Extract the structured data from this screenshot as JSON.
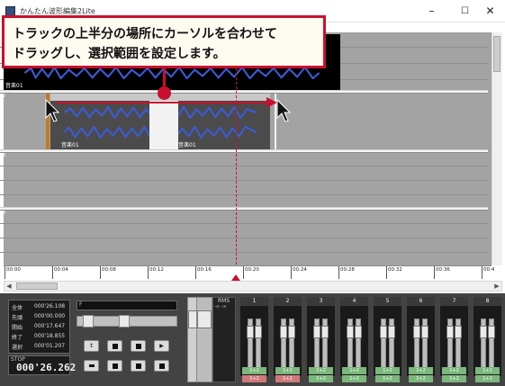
{
  "window": {
    "title": "かんたん波形編集2Lite",
    "controls": {
      "minimize": "–",
      "maximize": "☐",
      "close": "✕"
    }
  },
  "callout": {
    "line1": "トラックの上半分の場所にカーソルを合わせて",
    "line2": "ドラッグし、選択範囲を設定します。"
  },
  "tracks": [
    {
      "number": "1",
      "clips": [
        {
          "label": "音楽01"
        }
      ]
    },
    {
      "number": "2",
      "clips": [
        {
          "label": "音楽01"
        },
        {
          "label": "音楽01"
        }
      ]
    },
    {
      "number": "3",
      "clips": []
    },
    {
      "number": "4",
      "clips": []
    }
  ],
  "timeline": {
    "ticks": [
      "00:00",
      "00:04",
      "00:08",
      "00:12",
      "00:16",
      "00:20",
      "00:24",
      "00:28",
      "00:32",
      "00:36",
      "00:4"
    ]
  },
  "info": {
    "rows": [
      {
        "key": "全体",
        "value": "000'26.108"
      },
      {
        "key": "先頭",
        "value": "000'00.000"
      },
      {
        "key": "開始",
        "value": "000'17.647"
      },
      {
        "key": "終了",
        "value": "000'18.855"
      },
      {
        "key": "選択",
        "value": "000'01.207"
      }
    ],
    "state": "STOP",
    "counter": "000'26.262"
  },
  "lcd": {
    "text": "F"
  },
  "transport": {
    "row1": [
      "↕",
      "■",
      "■",
      "▶"
    ],
    "row2": [
      "▬",
      "■",
      "■",
      "■"
    ]
  },
  "rms": {
    "title": "RMS",
    "values": "-∞  -∞"
  },
  "channels": [
    {
      "number": "1",
      "a": "1+2",
      "b": "1+2",
      "b_color": "#cf7a7a"
    },
    {
      "number": "2",
      "a": "1+2",
      "b": "1+2",
      "b_color": "#cf7a7a"
    },
    {
      "number": "3",
      "a": "1+2",
      "b": "1+2",
      "b_color": "#7cb77c"
    },
    {
      "number": "4",
      "a": "1+2",
      "b": "1+2",
      "b_color": "#7cb77c"
    },
    {
      "number": "5",
      "a": "1+2",
      "b": "1+2",
      "b_color": "#7cb77c"
    },
    {
      "number": "6",
      "a": "1+2",
      "b": "1+2",
      "b_color": "#7cb77c"
    },
    {
      "number": "7",
      "a": "1+2",
      "b": "1+2",
      "b_color": "#7cb77c"
    },
    {
      "number": "8",
      "a": "1+2",
      "b": "1+2",
      "b_color": "#7cb77c"
    }
  ],
  "colors": {
    "accent": "#c8102e",
    "waveform": "#3b5bd6",
    "panel": "#434343",
    "track_bg": "#a3a3a3"
  }
}
